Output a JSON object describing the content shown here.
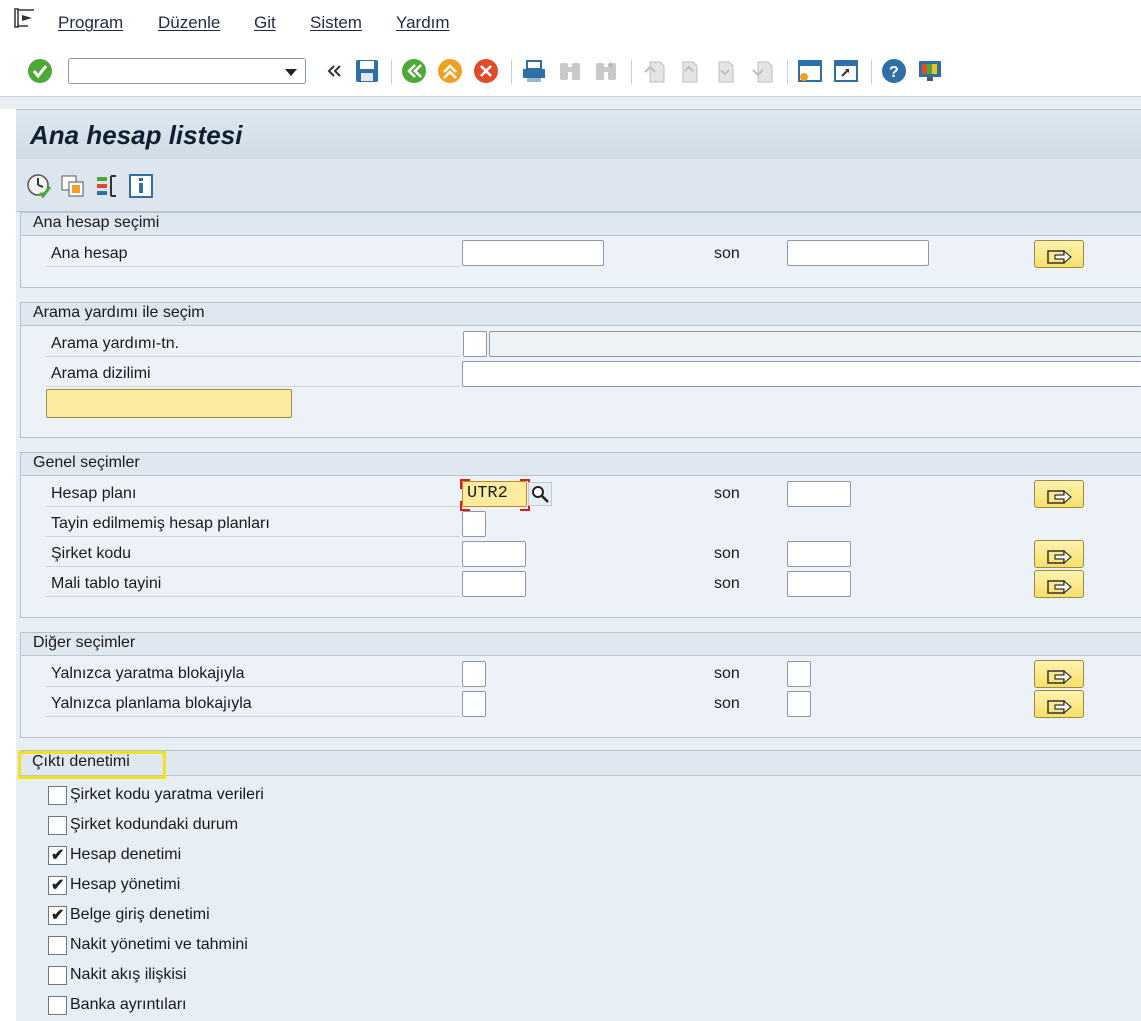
{
  "menu": {
    "items": [
      "Program",
      "Düzenle",
      "Git",
      "Sistem",
      "Yardım"
    ]
  },
  "toolbar": {
    "command_field_value": "",
    "icons": [
      "enter-check-icon",
      "command-dropdown-icon",
      "collapse-icon",
      "save-icon",
      "back-icon",
      "exit-icon",
      "cancel-icon",
      "print-icon",
      "find-icon",
      "find-next-icon",
      "first-page-icon",
      "previous-page-icon",
      "next-page-icon",
      "last-page-icon",
      "create-session-icon",
      "shortcut-icon",
      "help-icon",
      "customize-layout-icon"
    ]
  },
  "page": {
    "title": "Ana hesap listesi",
    "app_icons": [
      "execute-icon",
      "get-variant-icon",
      "selection-options-icon",
      "info-icon"
    ]
  },
  "groups": {
    "account_selection": {
      "title": "Ana hesap seçimi",
      "rows": [
        {
          "label": "Ana hesap",
          "from": "",
          "to_label": "son",
          "to": ""
        }
      ]
    },
    "search_help": {
      "title": "Arama yardımı ile seçim",
      "rows": [
        {
          "label": "Arama yardımı-tn.",
          "value": ""
        },
        {
          "label": "Arama dizilimi",
          "value": ""
        }
      ],
      "button_label": ""
    },
    "general": {
      "title": "Genel seçimler",
      "rows": [
        {
          "label": "Hesap planı",
          "from": "UTR2",
          "to_label": "son",
          "to": ""
        },
        {
          "label": "Tayin edilmemiş hesap planları",
          "from": ""
        },
        {
          "label": "Şirket kodu",
          "from": "",
          "to_label": "son",
          "to": ""
        },
        {
          "label": "Mali tablo tayini",
          "from": "",
          "to_label": "son",
          "to": ""
        }
      ]
    },
    "other": {
      "title": "Diğer seçimler",
      "rows": [
        {
          "label": "Yalnızca yaratma blokajıyla",
          "from": "",
          "to_label": "son",
          "to": ""
        },
        {
          "label": "Yalnızca planlama blokajıyla",
          "from": "",
          "to_label": "son",
          "to": ""
        }
      ]
    },
    "output": {
      "title": "Çıktı denetimi",
      "checkboxes": [
        {
          "label": "Şirket kodu yaratma verileri",
          "checked": false
        },
        {
          "label": "Şirket kodundaki durum",
          "checked": false
        },
        {
          "label": "Hesap denetimi",
          "checked": true
        },
        {
          "label": "Hesap yönetimi",
          "checked": true
        },
        {
          "label": "Belge giriş denetimi",
          "checked": true
        },
        {
          "label": "Nakit yönetimi ve tahmini",
          "checked": false
        },
        {
          "label": "Nakit akış ilişkisi",
          "checked": false
        },
        {
          "label": "Banka ayrıntıları",
          "checked": false
        }
      ],
      "check_mark": "✔"
    }
  },
  "colors": {
    "highlight": "#f2e21c",
    "multiselect_button": "#f6df6a",
    "required_marker": "#d62020"
  }
}
